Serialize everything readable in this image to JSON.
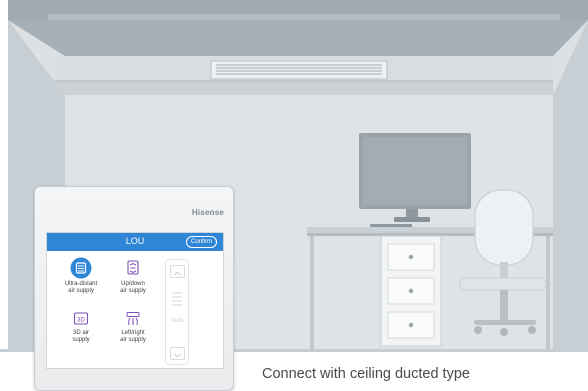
{
  "device": {
    "brand": "Hisense",
    "screen_title": "LOU",
    "confirm_label": "Confirm",
    "modes": [
      {
        "label_line1": "Ultra-distant",
        "label_line2": "air supply",
        "icon": "ultra-distant-air-icon",
        "selected": true
      },
      {
        "label_line1": "Up/down",
        "label_line2": "air supply",
        "icon": "up-down-air-icon",
        "selected": false
      },
      {
        "label_line1": "3D air",
        "label_line2": "supply",
        "icon": "3d-air-icon",
        "icon_text": "3D",
        "selected": false
      },
      {
        "label_line1": "Left/right",
        "label_line2": "air supply",
        "icon": "left-right-air-icon",
        "selected": false
      }
    ],
    "side_auto_label": "Auto"
  },
  "caption": "Connect with ceiling ducted type",
  "colors": {
    "accent": "#2f86d6",
    "room_wall": "#d9dde0",
    "ceiling": "#a9b3bb"
  }
}
